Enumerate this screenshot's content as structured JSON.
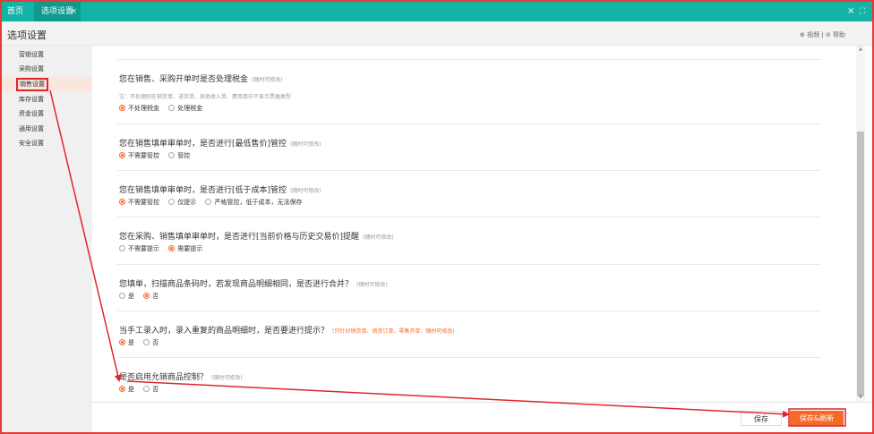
{
  "tabs": {
    "home": "首页",
    "active": "选项设置",
    "close": "×"
  },
  "window": {
    "close": "×",
    "maximize": "⛶"
  },
  "header": {
    "title": "选项设置",
    "video": "⊕ 视频",
    "sep": "|",
    "help": "⊘ 帮助"
  },
  "sidebar": {
    "items": [
      {
        "label": "营销设置"
      },
      {
        "label": "采购设置"
      },
      {
        "label": "销售设置"
      },
      {
        "label": "库存设置"
      },
      {
        "label": "资金设置"
      },
      {
        "label": "通用设置"
      },
      {
        "label": "安全设置"
      }
    ]
  },
  "sections": [
    {
      "title": "您在销售、采购开单时是否处理税金",
      "tag": "(随时可修改)",
      "note": "注：不处理则在销货单、进货单、其他收入单、费用单中不显示票据类型",
      "options": [
        {
          "label": "不处理税金",
          "selected": true
        },
        {
          "label": "处理税金",
          "selected": false
        }
      ]
    },
    {
      "title": "您在销售填单审单时，是否进行[最低售价]管控",
      "tag": "(随时可修改)",
      "options": [
        {
          "label": "不需要管控",
          "selected": true
        },
        {
          "label": "管控",
          "selected": false
        }
      ]
    },
    {
      "title": "您在销售填单审单时，是否进行[低于成本]管控",
      "tag": "(随时可修改)",
      "options": [
        {
          "label": "不需要管控",
          "selected": true
        },
        {
          "label": "仅提示",
          "selected": false
        },
        {
          "label": "严格管控，低于成本，无法保存",
          "selected": false
        }
      ]
    },
    {
      "title": "您在采购、销售填单审单时，是否进行[当前价格与历史交易价]提醒",
      "tag": "(随时可修改)",
      "options": [
        {
          "label": "不需要提示",
          "selected": false
        },
        {
          "label": "需要提示",
          "selected": true
        }
      ]
    },
    {
      "title": "您填单，扫描商品条码时，若发现商品明细相同，是否进行合并？",
      "tag": "(随时可修改)",
      "options": [
        {
          "label": "是",
          "selected": false
        },
        {
          "label": "否",
          "selected": true
        }
      ]
    },
    {
      "title": "当手工录入时，录入重复的商品明细时，是否要进行提示？",
      "tag": "(只针对销货单、销货订单、零售开单，随时可修改)",
      "options": [
        {
          "label": "是",
          "selected": true
        },
        {
          "label": "否",
          "selected": false
        }
      ]
    },
    {
      "title": "是否启用允销商品控制？",
      "tag": "(随时可修改)",
      "options": [
        {
          "label": "是",
          "selected": true
        },
        {
          "label": "否",
          "selected": false
        }
      ]
    }
  ],
  "footer": {
    "save": "保存",
    "save_refresh": "保存&刷新"
  },
  "scroll": {
    "up": "▲",
    "down": "▼"
  },
  "colors": {
    "teal": "#14b3a6",
    "accent": "#f56a2b",
    "annotation_red": "#e0262a"
  }
}
